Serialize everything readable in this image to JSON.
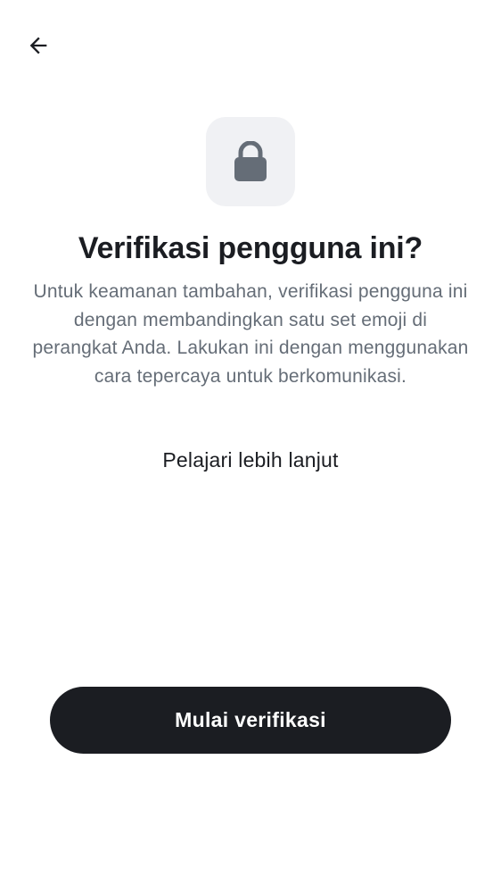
{
  "header": {
    "back_icon": "arrow-left-icon"
  },
  "hero": {
    "icon": "lock-icon",
    "title": "Verifikasi pengguna ini?",
    "description": "Untuk keamanan tambahan, verifikasi pengguna ini dengan membandingkan satu set emoji di perangkat Anda. Lakukan ini dengan menggunakan cara tepercaya untuk berkomunikasi.",
    "learn_more_label": "Pelajari lebih lanjut"
  },
  "actions": {
    "start_label": "Mulai verifikasi"
  },
  "colors": {
    "primary": "#1b1d22",
    "secondary_text": "#656d77",
    "icon_tile_bg": "#f0f1f4",
    "icon": "#656d77",
    "background": "#ffffff"
  }
}
